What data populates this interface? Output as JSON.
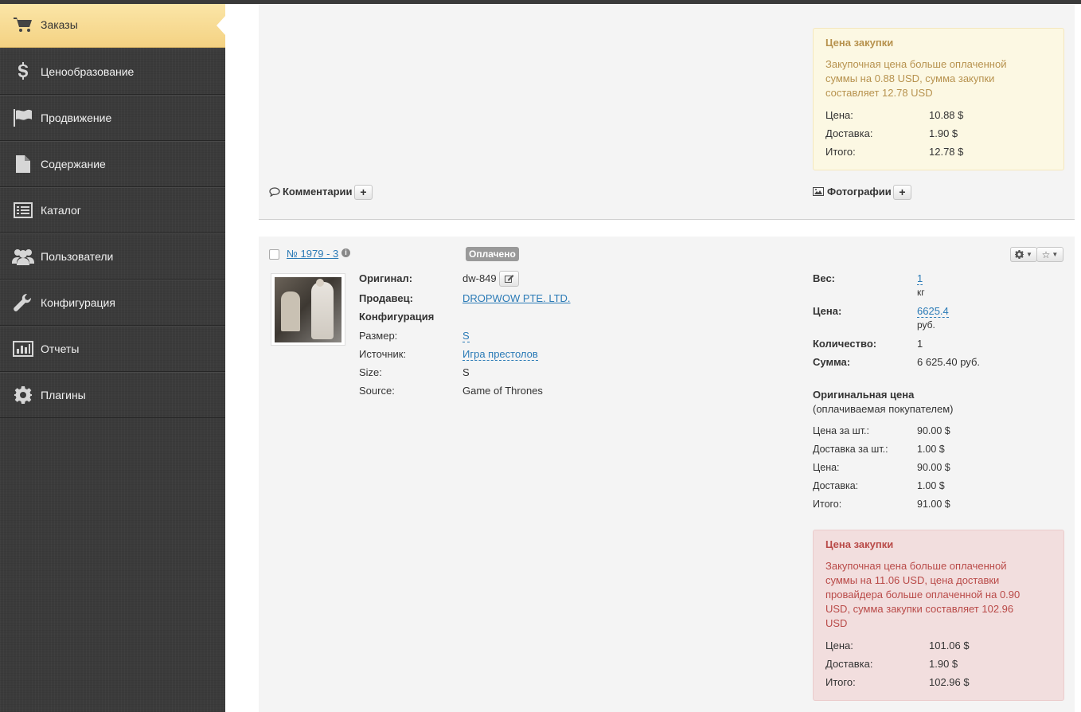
{
  "sidebar": {
    "items": [
      {
        "label": "Заказы",
        "icon": "cart-icon"
      },
      {
        "label": "Ценообразование",
        "icon": "dollar-icon"
      },
      {
        "label": "Продвижение",
        "icon": "flag-icon"
      },
      {
        "label": "Содержание",
        "icon": "document-icon"
      },
      {
        "label": "Каталог",
        "icon": "list-icon"
      },
      {
        "label": "Пользователи",
        "icon": "users-icon"
      },
      {
        "label": "Конфигурация",
        "icon": "wrench-icon"
      },
      {
        "label": "Отчеты",
        "icon": "chart-icon"
      },
      {
        "label": "Плагины",
        "icon": "gear-icon"
      }
    ]
  },
  "order1": {
    "purchase_alert": {
      "title": "Цена закупки",
      "message": "Закупочная цена больше оплаченной суммы на 0.88 USD, сумма закупки составляет 12.78 USD",
      "rows": [
        {
          "label": "Цена:",
          "value": "10.88 $"
        },
        {
          "label": "Доставка:",
          "value": "1.90 $"
        },
        {
          "label": "Итого:",
          "value": "12.78 $"
        }
      ]
    },
    "comments_label": "Комментарии",
    "photos_label": "Фотографии",
    "plus": "+"
  },
  "order2": {
    "number": "№ 1979 - 3",
    "status": "Оплачено",
    "original_label": "Оригинал:",
    "original_value": "dw-849",
    "seller_label": "Продавец:",
    "seller_value": "DROPWOW PTE. LTD.",
    "config_label": "Конфигурация",
    "attributes": [
      {
        "label": "Размер:",
        "value": "S"
      },
      {
        "label": "Источник:",
        "value": "Игра престолов"
      },
      {
        "label": "Size:",
        "value": "S"
      },
      {
        "label": "Source:",
        "value": "Game of Thrones"
      }
    ],
    "weight_label": "Вес:",
    "weight_value": "1",
    "weight_unit": "кг",
    "price_label": "Цена:",
    "price_value": "6625.4",
    "price_unit": "руб.",
    "qty_label": "Количество:",
    "qty_value": "1",
    "sum_label": "Сумма:",
    "sum_value": "6 625.40 руб.",
    "orig_price_title": "Оригинальная цена",
    "orig_price_sub": "(оплачиваемая покупателем)",
    "orig_rows": [
      {
        "label": "Цена за шт.:",
        "value": "90.00 $"
      },
      {
        "label": "Доставка за шт.:",
        "value": "1.00 $"
      },
      {
        "label": "Цена:",
        "value": "90.00 $"
      },
      {
        "label": "Доставка:",
        "value": "1.00 $"
      },
      {
        "label": "Итого:",
        "value": "91.00 $"
      }
    ],
    "purchase_alert": {
      "title": "Цена закупки",
      "message": "Закупочная цена больше оплаченной суммы на 11.06 USD, цена доставки провайдера больше оплаченной на 0.90 USD, сумма закупки составляет 102.96 USD",
      "rows": [
        {
          "label": "Цена:",
          "value": "101.06 $"
        },
        {
          "label": "Доставка:",
          "value": "1.90 $"
        },
        {
          "label": "Итого:",
          "value": "102.96 $"
        }
      ]
    }
  }
}
